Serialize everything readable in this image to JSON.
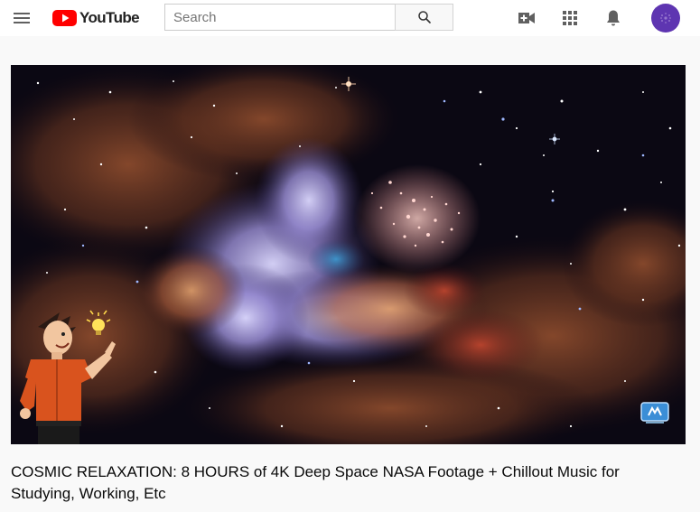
{
  "header": {
    "logo_text": "YouTube",
    "search": {
      "placeholder": "Search",
      "value": ""
    },
    "icons": [
      "menu-icon",
      "youtube-logo-icon",
      "search-icon",
      "create-video-icon",
      "apps-grid-icon",
      "notifications-bell-icon",
      "account-avatar"
    ],
    "colors": {
      "brand_red": "#ff0000",
      "avatar": "#5e35b1",
      "icon_gray": "#606060"
    }
  },
  "video": {
    "title": "COSMIC RELAXATION: 8 HOURS of 4K Deep Space NASA Footage + Chillout Music for Studying, Working, Etc",
    "overlay": "animated cartoon character pointing at a light bulb",
    "watermark": "channel-logo-icon"
  }
}
